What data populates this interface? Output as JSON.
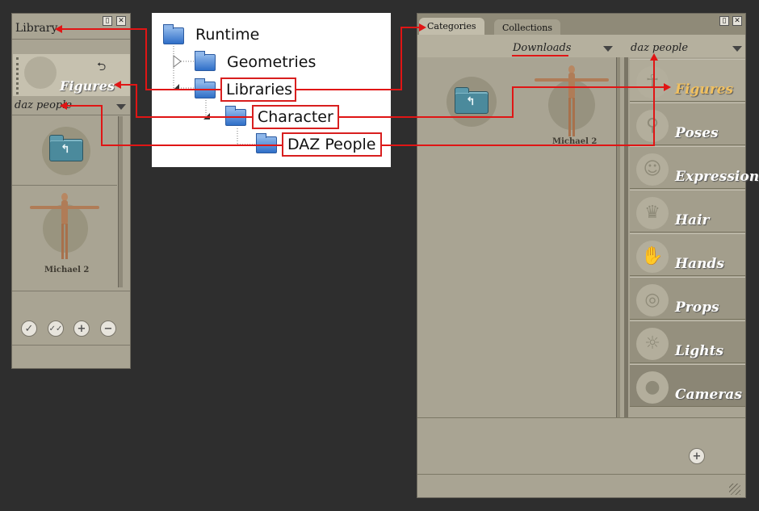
{
  "left_panel": {
    "title": "Library",
    "category": "Figures",
    "folder": "daz people",
    "figure_label": "Michael 2",
    "buttons": [
      "✓",
      "✓✓",
      "+",
      "−"
    ]
  },
  "tree": {
    "nodes": [
      "Runtime",
      "Geometries",
      "Libraries",
      "Character",
      "DAZ People"
    ]
  },
  "right_panel": {
    "tabs": [
      "Categories",
      "Collections"
    ],
    "dropdown_left": "Downloads",
    "dropdown_right": "daz people",
    "figure_label": "Michael 2",
    "categories": [
      "Figures",
      "Poses",
      "Expression",
      "Hair",
      "Hands",
      "Props",
      "Lights",
      "Cameras"
    ],
    "active_category_color": "#f0c060"
  },
  "colors": {
    "annotation": "#e01515",
    "panel": "#a9a493",
    "background": "#2e2e2e"
  }
}
